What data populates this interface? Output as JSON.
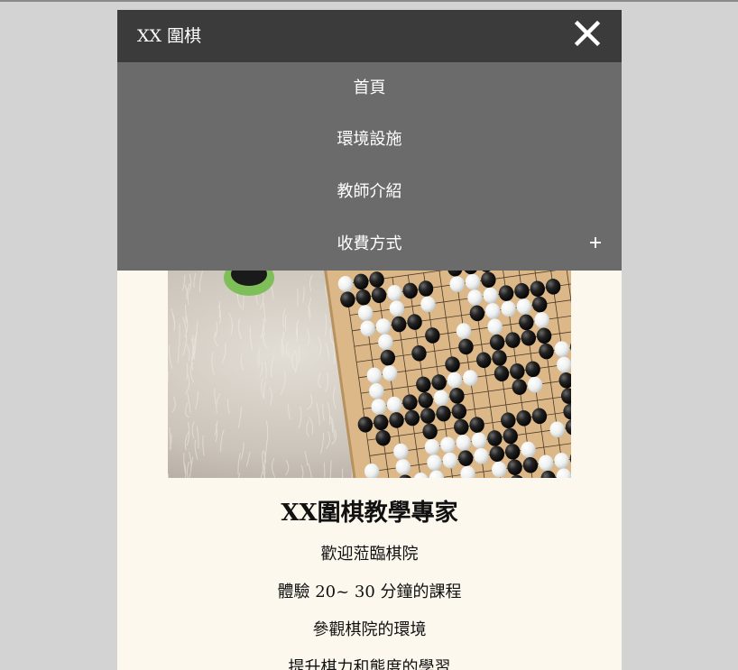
{
  "header": {
    "brand": "XX 圍棋",
    "close_icon": "close-icon"
  },
  "menu": {
    "items": [
      {
        "label": "首頁"
      },
      {
        "label": "環境設施"
      },
      {
        "label": "教師介紹"
      },
      {
        "label": "收費方式",
        "expand_icon": "plus-icon"
      }
    ]
  },
  "hero": {
    "image": "go-board-photo"
  },
  "main": {
    "title": "XX圍棋教學專家",
    "lines": [
      "歡迎蒞臨棋院",
      "體驗 20~ 30 分鐘的課程",
      "參觀棋院的環境",
      "提升棋力和態度的學習"
    ]
  },
  "colors": {
    "topbar": "#3b3b3b",
    "menu": "#6b6b6b",
    "page_bg": "#fdf8ee",
    "outer_bg": "#d3d3d3"
  }
}
